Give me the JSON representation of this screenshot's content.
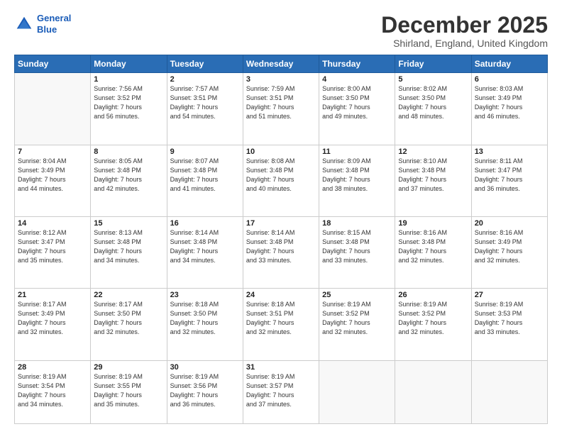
{
  "header": {
    "logo_line1": "General",
    "logo_line2": "Blue",
    "month": "December 2025",
    "location": "Shirland, England, United Kingdom"
  },
  "weekdays": [
    "Sunday",
    "Monday",
    "Tuesday",
    "Wednesday",
    "Thursday",
    "Friday",
    "Saturday"
  ],
  "weeks": [
    [
      {
        "day": "",
        "info": ""
      },
      {
        "day": "1",
        "info": "Sunrise: 7:56 AM\nSunset: 3:52 PM\nDaylight: 7 hours\nand 56 minutes."
      },
      {
        "day": "2",
        "info": "Sunrise: 7:57 AM\nSunset: 3:51 PM\nDaylight: 7 hours\nand 54 minutes."
      },
      {
        "day": "3",
        "info": "Sunrise: 7:59 AM\nSunset: 3:51 PM\nDaylight: 7 hours\nand 51 minutes."
      },
      {
        "day": "4",
        "info": "Sunrise: 8:00 AM\nSunset: 3:50 PM\nDaylight: 7 hours\nand 49 minutes."
      },
      {
        "day": "5",
        "info": "Sunrise: 8:02 AM\nSunset: 3:50 PM\nDaylight: 7 hours\nand 48 minutes."
      },
      {
        "day": "6",
        "info": "Sunrise: 8:03 AM\nSunset: 3:49 PM\nDaylight: 7 hours\nand 46 minutes."
      }
    ],
    [
      {
        "day": "7",
        "info": "Sunrise: 8:04 AM\nSunset: 3:49 PM\nDaylight: 7 hours\nand 44 minutes."
      },
      {
        "day": "8",
        "info": "Sunrise: 8:05 AM\nSunset: 3:48 PM\nDaylight: 7 hours\nand 42 minutes."
      },
      {
        "day": "9",
        "info": "Sunrise: 8:07 AM\nSunset: 3:48 PM\nDaylight: 7 hours\nand 41 minutes."
      },
      {
        "day": "10",
        "info": "Sunrise: 8:08 AM\nSunset: 3:48 PM\nDaylight: 7 hours\nand 40 minutes."
      },
      {
        "day": "11",
        "info": "Sunrise: 8:09 AM\nSunset: 3:48 PM\nDaylight: 7 hours\nand 38 minutes."
      },
      {
        "day": "12",
        "info": "Sunrise: 8:10 AM\nSunset: 3:48 PM\nDaylight: 7 hours\nand 37 minutes."
      },
      {
        "day": "13",
        "info": "Sunrise: 8:11 AM\nSunset: 3:47 PM\nDaylight: 7 hours\nand 36 minutes."
      }
    ],
    [
      {
        "day": "14",
        "info": "Sunrise: 8:12 AM\nSunset: 3:47 PM\nDaylight: 7 hours\nand 35 minutes."
      },
      {
        "day": "15",
        "info": "Sunrise: 8:13 AM\nSunset: 3:48 PM\nDaylight: 7 hours\nand 34 minutes."
      },
      {
        "day": "16",
        "info": "Sunrise: 8:14 AM\nSunset: 3:48 PM\nDaylight: 7 hours\nand 34 minutes."
      },
      {
        "day": "17",
        "info": "Sunrise: 8:14 AM\nSunset: 3:48 PM\nDaylight: 7 hours\nand 33 minutes."
      },
      {
        "day": "18",
        "info": "Sunrise: 8:15 AM\nSunset: 3:48 PM\nDaylight: 7 hours\nand 33 minutes."
      },
      {
        "day": "19",
        "info": "Sunrise: 8:16 AM\nSunset: 3:48 PM\nDaylight: 7 hours\nand 32 minutes."
      },
      {
        "day": "20",
        "info": "Sunrise: 8:16 AM\nSunset: 3:49 PM\nDaylight: 7 hours\nand 32 minutes."
      }
    ],
    [
      {
        "day": "21",
        "info": "Sunrise: 8:17 AM\nSunset: 3:49 PM\nDaylight: 7 hours\nand 32 minutes."
      },
      {
        "day": "22",
        "info": "Sunrise: 8:17 AM\nSunset: 3:50 PM\nDaylight: 7 hours\nand 32 minutes."
      },
      {
        "day": "23",
        "info": "Sunrise: 8:18 AM\nSunset: 3:50 PM\nDaylight: 7 hours\nand 32 minutes."
      },
      {
        "day": "24",
        "info": "Sunrise: 8:18 AM\nSunset: 3:51 PM\nDaylight: 7 hours\nand 32 minutes."
      },
      {
        "day": "25",
        "info": "Sunrise: 8:19 AM\nSunset: 3:52 PM\nDaylight: 7 hours\nand 32 minutes."
      },
      {
        "day": "26",
        "info": "Sunrise: 8:19 AM\nSunset: 3:52 PM\nDaylight: 7 hours\nand 32 minutes."
      },
      {
        "day": "27",
        "info": "Sunrise: 8:19 AM\nSunset: 3:53 PM\nDaylight: 7 hours\nand 33 minutes."
      }
    ],
    [
      {
        "day": "28",
        "info": "Sunrise: 8:19 AM\nSunset: 3:54 PM\nDaylight: 7 hours\nand 34 minutes."
      },
      {
        "day": "29",
        "info": "Sunrise: 8:19 AM\nSunset: 3:55 PM\nDaylight: 7 hours\nand 35 minutes."
      },
      {
        "day": "30",
        "info": "Sunrise: 8:19 AM\nSunset: 3:56 PM\nDaylight: 7 hours\nand 36 minutes."
      },
      {
        "day": "31",
        "info": "Sunrise: 8:19 AM\nSunset: 3:57 PM\nDaylight: 7 hours\nand 37 minutes."
      },
      {
        "day": "",
        "info": ""
      },
      {
        "day": "",
        "info": ""
      },
      {
        "day": "",
        "info": ""
      }
    ]
  ]
}
